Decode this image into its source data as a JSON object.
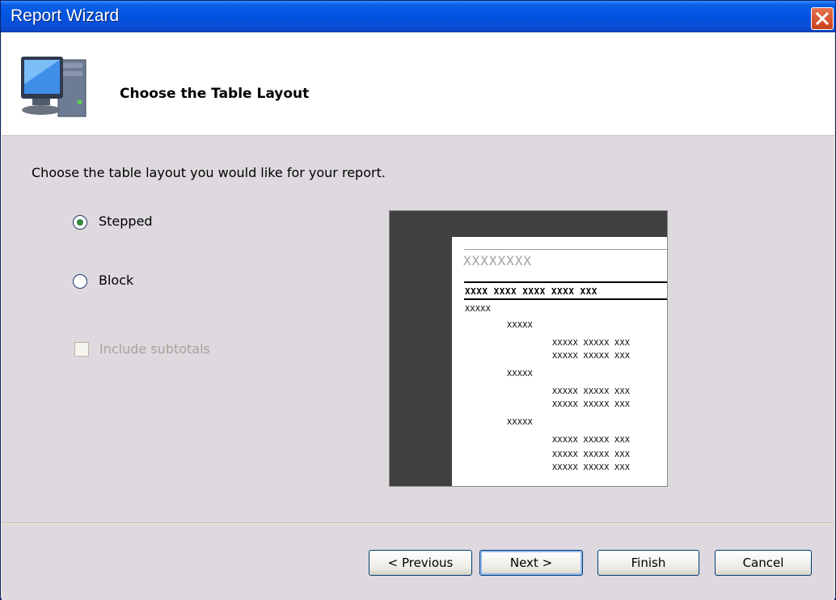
{
  "window": {
    "title": "Report Wizard"
  },
  "header": {
    "title": "Choose the Table Layout",
    "icon": "computer-icon"
  },
  "instruction": "Choose the table layout you would like for your report.",
  "options": {
    "stepped": {
      "label": "Stepped",
      "selected": true
    },
    "block": {
      "label": "Block",
      "selected": false
    },
    "subtotals": {
      "label": "Include subtotals",
      "checked": false,
      "enabled": false
    }
  },
  "preview": {
    "title": "XXXXXXXX",
    "header_row": "XXXX XXXX XXXX XXXX XXX",
    "group_label": "XXXXX",
    "row_cells": "XXXXX XXXXX XXX"
  },
  "buttons": {
    "previous": "< Previous",
    "next": "Next >",
    "finish": "Finish",
    "cancel": "Cancel"
  },
  "colors": {
    "titlebar": "#0054e3",
    "close": "#d4512b",
    "accent": "#2f8a3f"
  }
}
